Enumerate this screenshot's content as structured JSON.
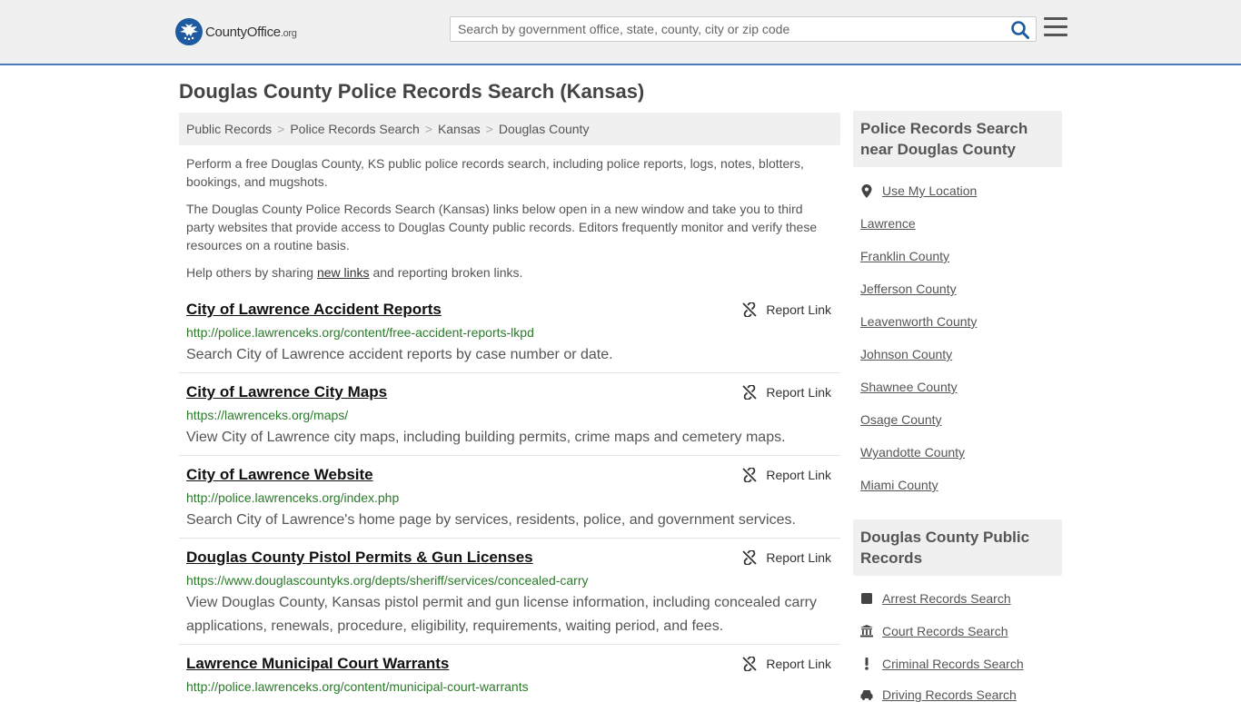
{
  "header": {
    "logo_main": "CountyOffice",
    "logo_suffix": ".org",
    "search_placeholder": "Search by government office, state, county, city or zip code"
  },
  "page_title": "Douglas County Police Records Search (Kansas)",
  "breadcrumb": [
    "Public Records",
    "Police Records Search",
    "Kansas",
    "Douglas County"
  ],
  "intro": {
    "p1": "Perform a free Douglas County, KS public police records search, including police reports, logs, notes, blotters, bookings, and mugshots.",
    "p2": "The Douglas County Police Records Search (Kansas) links below open in a new window and take you to third party websites that provide access to Douglas County public records. Editors frequently monitor and verify these resources on a routine basis.",
    "p3_before": "Help others by sharing ",
    "p3_link": "new links",
    "p3_after": " and reporting broken links."
  },
  "report_label": "Report Link",
  "results": [
    {
      "title": "City of Lawrence Accident Reports",
      "url": "http://police.lawrenceks.org/content/free-accident-reports-lkpd",
      "desc": "Search City of Lawrence accident reports by case number or date."
    },
    {
      "title": "City of Lawrence City Maps",
      "url": "https://lawrenceks.org/maps/",
      "desc": "View City of Lawrence city maps, including building permits, crime maps and cemetery maps."
    },
    {
      "title": "City of Lawrence Website",
      "url": "http://police.lawrenceks.org/index.php",
      "desc": "Search City of Lawrence's home page by services, residents, police, and government services."
    },
    {
      "title": "Douglas County Pistol Permits & Gun Licenses",
      "url": "https://www.douglascountyks.org/depts/sheriff/services/concealed-carry",
      "desc": "View Douglas County, Kansas pistol permit and gun license information, including concealed carry applications, renewals, procedure, eligibility, requirements, waiting period, and fees."
    },
    {
      "title": "Lawrence Municipal Court Warrants",
      "url": "http://police.lawrenceks.org/content/municipal-court-warrants",
      "desc": ""
    }
  ],
  "sidebar": {
    "near_heading": "Police Records Search near Douglas County",
    "use_location": "Use My Location",
    "near_links": [
      "Lawrence",
      "Franklin County",
      "Jefferson County",
      "Leavenworth County",
      "Johnson County",
      "Shawnee County",
      "Osage County",
      "Wyandotte County",
      "Miami County"
    ],
    "public_heading": "Douglas County Public Records",
    "public_links": [
      {
        "label": "Arrest Records Search",
        "icon": "square-icon"
      },
      {
        "label": "Court Records Search",
        "icon": "courthouse-icon"
      },
      {
        "label": "Criminal Records Search",
        "icon": "exclamation-icon"
      },
      {
        "label": "Driving Records Search",
        "icon": "car-icon"
      }
    ]
  }
}
